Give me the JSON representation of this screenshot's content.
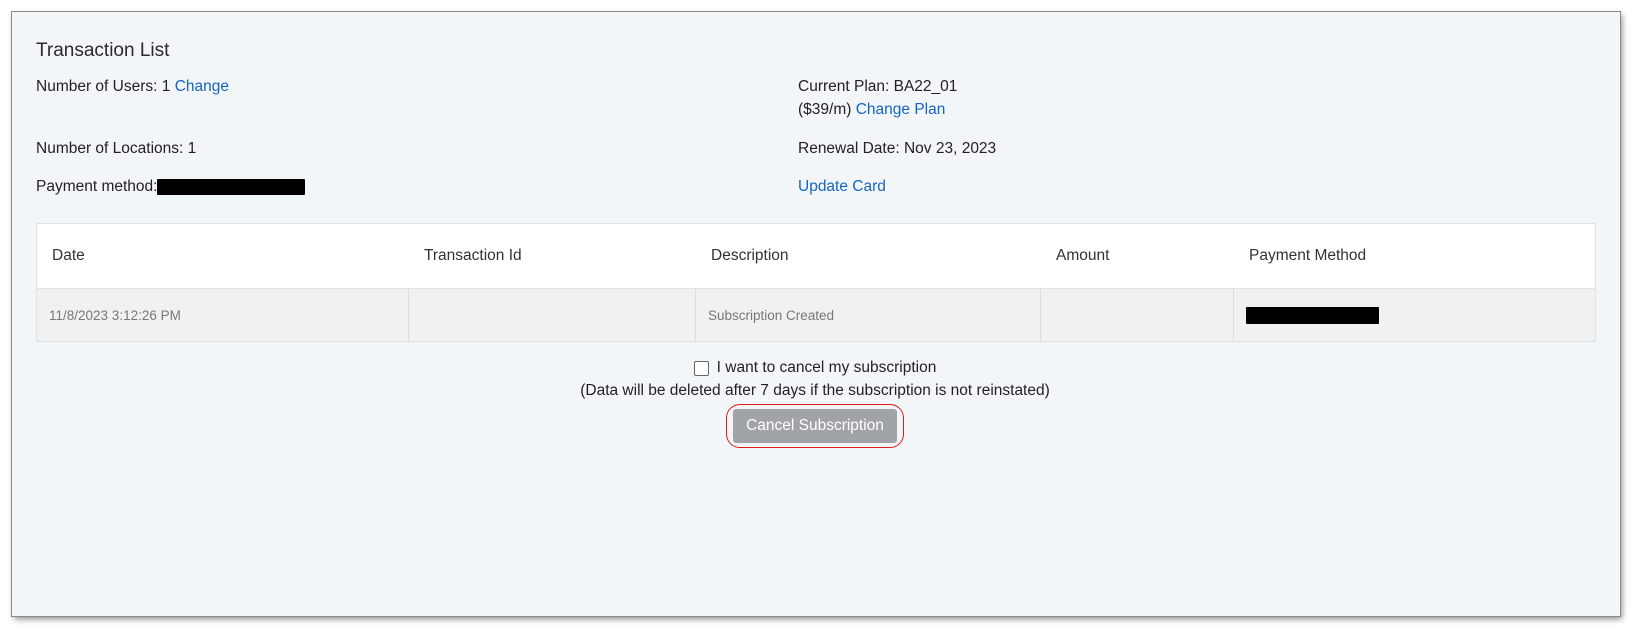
{
  "page": {
    "title": "Transaction List"
  },
  "account": {
    "users_label": "Number of Users: 1",
    "users_change": "Change",
    "locations_label": "Number of Locations: 1",
    "payment_label": "Payment method:",
    "plan_label": "Current Plan: BA22_01",
    "plan_price": "($39/m)",
    "change_plan": "Change Plan",
    "renewal_label": "Renewal Date: Nov 23, 2023",
    "update_card": "Update Card"
  },
  "table": {
    "columns": [
      "Date",
      "Transaction Id",
      "Description",
      "Amount",
      "Payment Method"
    ],
    "rows": [
      {
        "date": "11/8/2023 3:12:26 PM",
        "transaction_id": "",
        "description": "Subscription Created",
        "amount": "",
        "payment_method": ""
      }
    ]
  },
  "cancel": {
    "checkbox_label": "I want to cancel my subscription",
    "checked": false,
    "note": "(Data will be deleted after 7 days if the subscription is not reinstated)",
    "button_label": "Cancel Subscription"
  },
  "colors": {
    "link": "#1565c0",
    "button_bg": "#a0a4a8",
    "highlight_ring": "#e01b1b",
    "page_bg": "#f3f6f9"
  }
}
